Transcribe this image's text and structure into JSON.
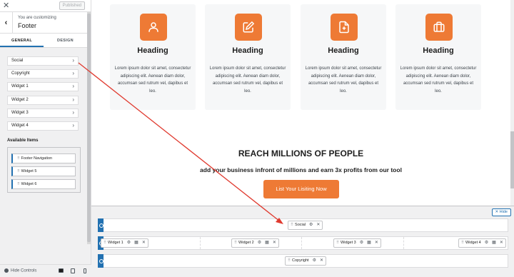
{
  "topbar": {
    "close": "✕",
    "publish_label": "Published"
  },
  "breadcrumb": {
    "back": "‹",
    "sub": "You are customizing",
    "title": "Footer"
  },
  "tabs": [
    {
      "label": "GENERAL"
    },
    {
      "label": "DESIGN"
    }
  ],
  "sections": [
    {
      "label": "Social"
    },
    {
      "label": "Copyright"
    },
    {
      "label": "Widget 1"
    },
    {
      "label": "Widget 2"
    },
    {
      "label": "Widget 3"
    },
    {
      "label": "Widget 4"
    }
  ],
  "chevron": "›",
  "available": {
    "title": "Available Items",
    "items": [
      {
        "label": "Footer Navigation"
      },
      {
        "label": "Widget 5"
      },
      {
        "label": "Widget 6"
      }
    ]
  },
  "bottom": {
    "hide_controls": "Hide Controls"
  },
  "cards": [
    {
      "heading": "Heading",
      "icon": "user-icon",
      "text": "Lorem ipsum dolor sit amet, consectetur adipiscing elit. Aenean diam dolor, accumsan sed rutrum vel, dapibus et leo."
    },
    {
      "heading": "Heading",
      "icon": "edit-icon",
      "text": "Lorem ipsum dolor sit amet, consectetur adipiscing elit. Aenean diam dolor, accumsan sed rutrum vel, dapibus et leo."
    },
    {
      "heading": "Heading",
      "icon": "file-plus-icon",
      "text": "Lorem ipsum dolor sit amet, consectetur adipiscing elit. Aenean diam dolor, accumsan sed rutrum vel, dapibus et leo."
    },
    {
      "heading": "Heading",
      "icon": "briefcase-icon",
      "text": "Lorem ipsum dolor sit amet, consectetur adipiscing elit. Aenean diam dolor, accumsan sed rutrum vel, dapibus et leo."
    }
  ],
  "cta_section": {
    "title": "REACH MILLIONS OF PEOPLE",
    "subtitle": "add your business infront of millions and earn 3x profits from our tool",
    "button": "List Your Lisiting Now"
  },
  "builder": {
    "hide_label": "✕ Hide",
    "top_row": [
      {
        "label": "Social"
      }
    ],
    "main_row": [
      {
        "label": "Widget 1"
      },
      {
        "label": "Widget 2"
      },
      {
        "label": "Widget 3"
      },
      {
        "label": "Widget 4"
      }
    ],
    "bottom_row": [
      {
        "label": "Copyright"
      }
    ]
  },
  "colors": {
    "accent": "#ee7a35",
    "wp_blue": "#2271b1",
    "arrow": "#e03a2f"
  }
}
